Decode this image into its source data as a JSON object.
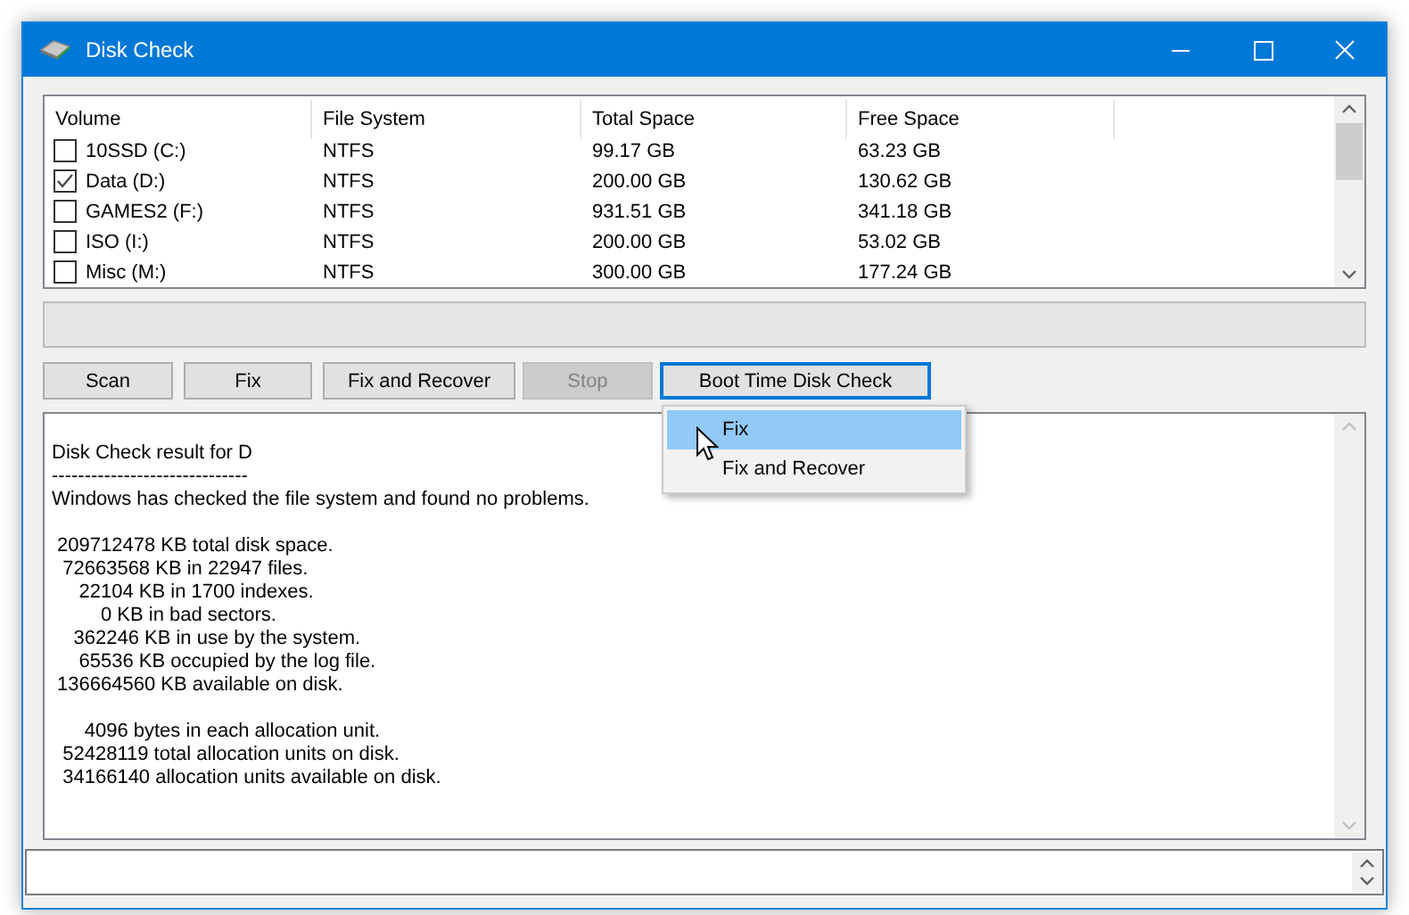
{
  "window": {
    "title": "Disk Check"
  },
  "table": {
    "columns": [
      "Volume",
      "File System",
      "Total Space",
      "Free Space"
    ],
    "rows": [
      {
        "checked": false,
        "cells": [
          "10SSD (C:)",
          "NTFS",
          "99.17 GB",
          "63.23 GB"
        ]
      },
      {
        "checked": true,
        "cells": [
          "Data (D:)",
          "NTFS",
          "200.00 GB",
          "130.62 GB"
        ]
      },
      {
        "checked": false,
        "cells": [
          "GAMES2 (F:)",
          "NTFS",
          "931.51 GB",
          "341.18 GB"
        ]
      },
      {
        "checked": false,
        "cells": [
          "ISO (I:)",
          "NTFS",
          "200.00 GB",
          "53.02 GB"
        ]
      },
      {
        "checked": false,
        "cells": [
          "Misc (M:)",
          "NTFS",
          "300.00 GB",
          "177.24 GB"
        ]
      }
    ]
  },
  "progress": {
    "level": 0
  },
  "buttons": [
    {
      "label": "Scan",
      "disabled": false,
      "focused": false
    },
    {
      "label": "Fix",
      "disabled": false,
      "focused": false
    },
    {
      "label": "Fix and Recover",
      "disabled": false,
      "focused": false
    },
    {
      "label": "Stop",
      "disabled": true,
      "focused": false
    },
    {
      "label": "Boot Time Disk Check",
      "disabled": false,
      "focused": true
    }
  ],
  "menu": {
    "items": [
      {
        "label": "Fix",
        "selected": true
      },
      {
        "label": "Fix and Recover",
        "selected": false
      }
    ]
  },
  "log": {
    "blocks": [
      [
        "Disk Check result for D",
        "------------------------------",
        "Windows has checked the file system and found no problems."
      ],
      [
        " 209712478 KB total disk space.",
        "  72663568 KB in 22947 files.",
        "     22104 KB in 1700 indexes.",
        "         0 KB in bad sectors.",
        "    362246 KB in use by the system.",
        "     65536 KB occupied by the log file.",
        " 136664560 KB available on disk."
      ],
      [
        "      4096 bytes in each allocation unit.",
        "  52428119 total allocation units on disk.",
        "  34166140 allocation units available on disk."
      ]
    ]
  }
}
